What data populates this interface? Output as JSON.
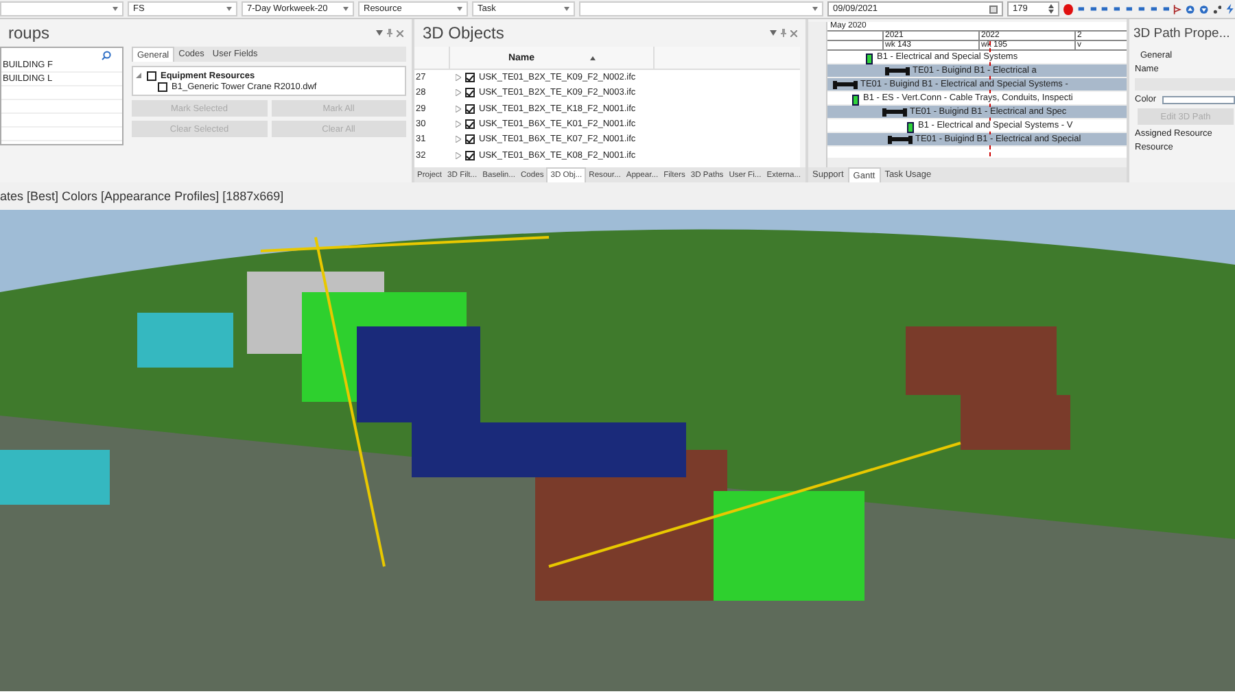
{
  "toolbar": {
    "dropdowns": [
      "FS",
      "7-Day Workweek-20",
      "Resource",
      "Task"
    ],
    "date": "09/09/2021",
    "frame": "179",
    "recording": true
  },
  "groups_panel": {
    "title": "roups",
    "list_items": [
      "BUILDING F",
      "BUILDING L"
    ],
    "tabs": [
      {
        "label": "General",
        "selected": true
      },
      {
        "label": "Codes",
        "selected": false
      },
      {
        "label": "User Fields",
        "selected": false
      }
    ],
    "tree": [
      {
        "label": "Equipment Resources",
        "checked": false,
        "expanded": true,
        "children": [
          {
            "label": "B1_Generic Tower Crane R2010.dwf",
            "checked": false
          }
        ]
      }
    ],
    "buttons": [
      {
        "label": "Mark Selected",
        "disabled": true
      },
      {
        "label": "Mark All",
        "disabled": true
      },
      {
        "label": "Clear Selected",
        "disabled": true
      },
      {
        "label": "Clear All",
        "disabled": true
      }
    ]
  },
  "objects_panel": {
    "title": "3D Objects",
    "column": "Name",
    "rows": [
      {
        "index": "27",
        "name": "USK_TE01_B2X_TE_K09_F2_N002.ifc",
        "checked": true
      },
      {
        "index": "28",
        "name": "USK_TE01_B2X_TE_K09_F2_N003.ifc",
        "checked": true
      },
      {
        "index": "29",
        "name": "USK_TE01_B2X_TE_K18_F2_N001.ifc",
        "checked": true
      },
      {
        "index": "30",
        "name": "USK_TE01_B6X_TE_K01_F2_N001.ifc",
        "checked": true
      },
      {
        "index": "31",
        "name": "USK_TE01_B6X_TE_K07_F2_N001.ifc",
        "checked": true
      },
      {
        "index": "32",
        "name": "USK_TE01_B6X_TE_K08_F2_N001.ifc",
        "checked": true
      }
    ],
    "tabs": [
      {
        "label": "Project",
        "selected": false
      },
      {
        "label": "3D Filt...",
        "selected": false
      },
      {
        "label": "Baselin...",
        "selected": false
      },
      {
        "label": "Codes",
        "selected": false
      },
      {
        "label": "3D Obj...",
        "selected": true
      },
      {
        "label": "Resour...",
        "selected": false
      },
      {
        "label": "Appear...",
        "selected": false
      },
      {
        "label": "Filters",
        "selected": false
      },
      {
        "label": "3D Paths",
        "selected": false
      },
      {
        "label": "User Fi...",
        "selected": false
      },
      {
        "label": "Externa...",
        "selected": false
      }
    ]
  },
  "gantt_panel": {
    "month": "May 2020",
    "years": [
      "2021",
      "2022",
      "2"
    ],
    "weeks": [
      "wk 143",
      "wk 195",
      "v"
    ],
    "rows": [
      {
        "kind": "task",
        "label": "B1 - Electrical and Special Systems"
      },
      {
        "kind": "summary",
        "label": "TE01 - Buigind B1 - Electrical a"
      },
      {
        "kind": "summary",
        "label": "TE01 - Buigind B1 - Electrical and Special Systems -"
      },
      {
        "kind": "task",
        "label": "B1 - ES -  Vert.Conn - Cable Trays, Conduits, Inspecti"
      },
      {
        "kind": "summary",
        "label": "TE01 - Buigind B1 - Electrical and Spec"
      },
      {
        "kind": "task",
        "label": "B1 - Electrical and Special Systems - V"
      },
      {
        "kind": "summary",
        "label": "TE01 - Buigind B1 - Electrical and Special"
      }
    ],
    "tabs": [
      {
        "label": "Support",
        "selected": false
      },
      {
        "label": "Gantt",
        "selected": true
      },
      {
        "label": "Task Usage",
        "selected": false
      }
    ]
  },
  "path_panel": {
    "title": "3D Path Prope...",
    "section": "General",
    "name_label": "Name",
    "color_label": "Color",
    "button": {
      "label": "Edit 3D Path",
      "disabled": true
    },
    "assigned_label": "Assigned Resource",
    "resource_label": "Resource"
  },
  "viewport": {
    "title": "ates [Best] Colors [Appearance Profiles] [1887x669]"
  }
}
